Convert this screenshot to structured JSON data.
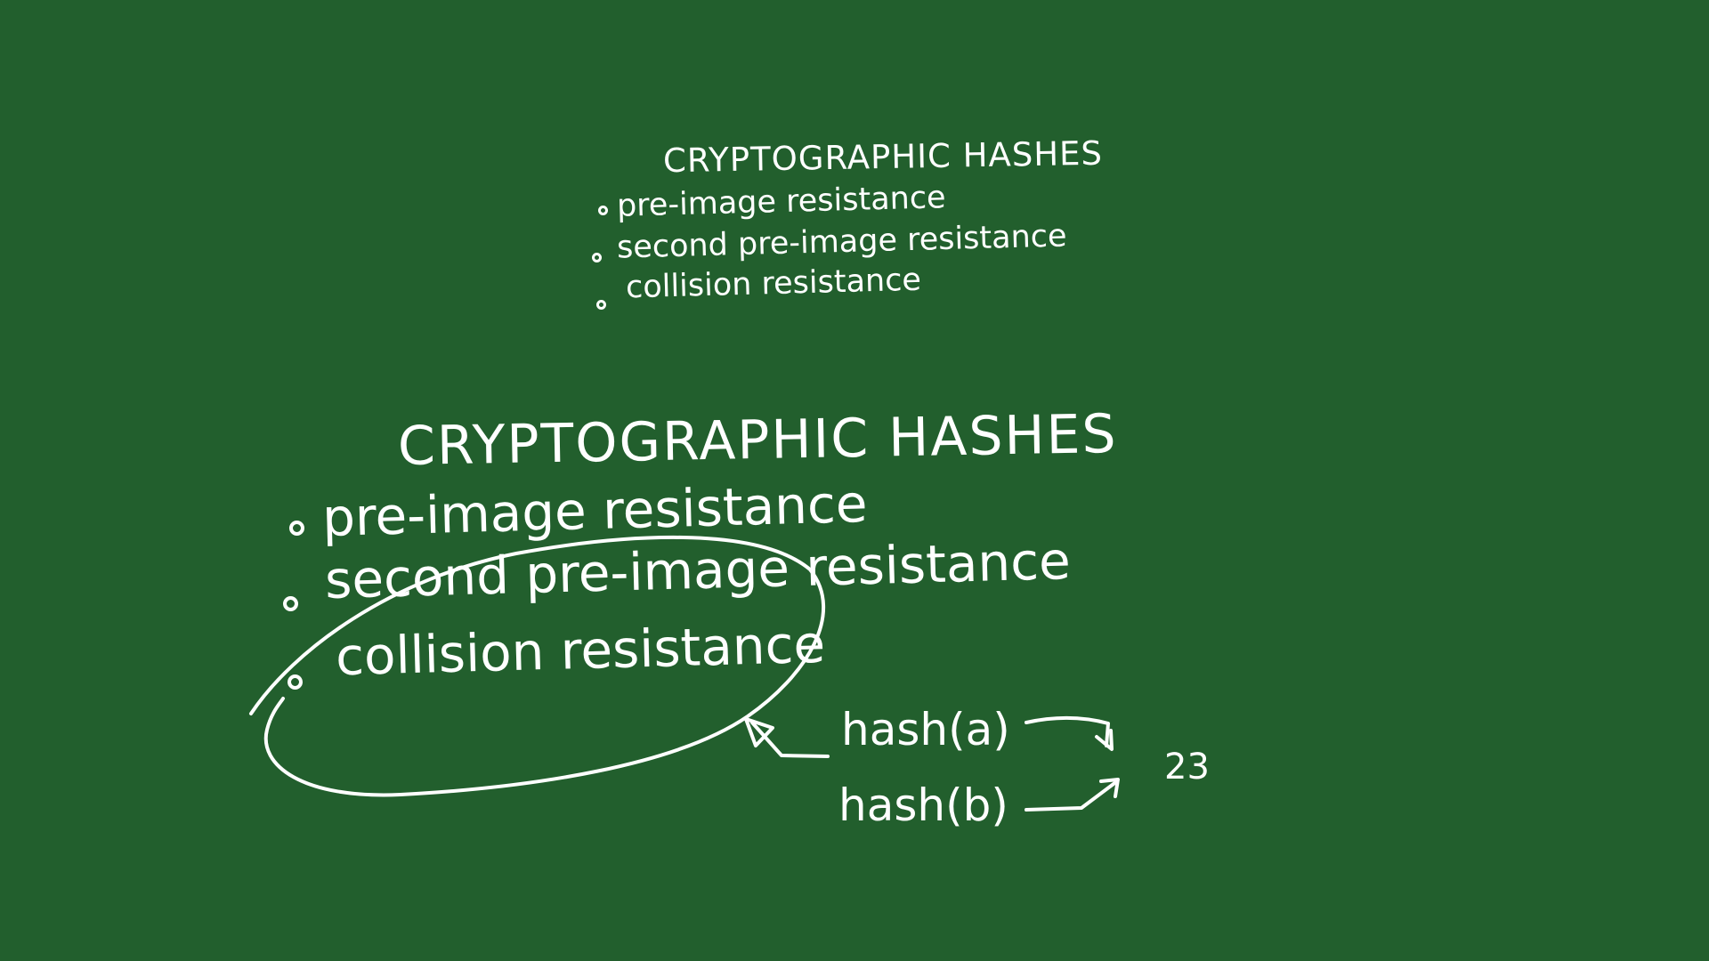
{
  "board": {
    "background_color": "#225f2d",
    "chalk_color": "#ffffff"
  },
  "top_note": {
    "title": "CRYPTOGRAPHIC HASHES",
    "items": [
      "pre-image resistance",
      "second pre-image resistance",
      "collision resistance"
    ]
  },
  "main_note": {
    "title": "CRYPTOGRAPHIC HASHES",
    "items": [
      "pre-image resistance",
      "second pre-image resistance",
      "collision resistance"
    ],
    "circled_item": "collision resistance"
  },
  "hash_example": {
    "hash_a": "hash(a)",
    "hash_b": "hash(b)",
    "shared_value": "23"
  }
}
